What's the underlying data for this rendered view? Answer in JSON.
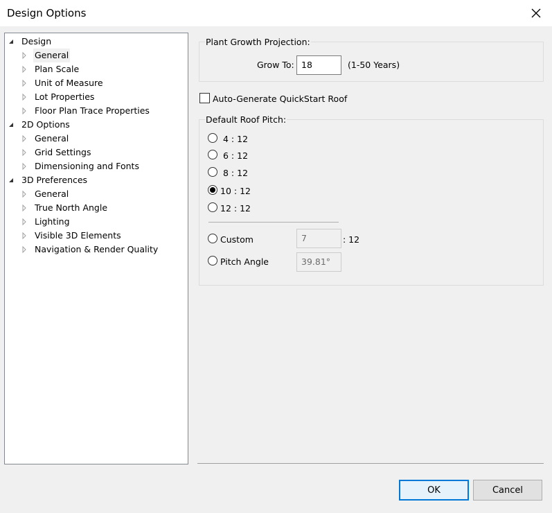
{
  "window": {
    "title": "Design Options"
  },
  "tree": {
    "items": [
      {
        "label": "Design",
        "level": 0,
        "expanded": true
      },
      {
        "label": "General",
        "level": 1,
        "selected": true
      },
      {
        "label": "Plan Scale",
        "level": 1
      },
      {
        "label": "Unit of Measure",
        "level": 1
      },
      {
        "label": "Lot Properties",
        "level": 1
      },
      {
        "label": "Floor Plan Trace Properties",
        "level": 1
      },
      {
        "label": "2D Options",
        "level": 0,
        "expanded": true
      },
      {
        "label": "General",
        "level": 1
      },
      {
        "label": "Grid Settings",
        "level": 1
      },
      {
        "label": "Dimensioning and Fonts",
        "level": 1
      },
      {
        "label": "3D Preferences",
        "level": 0,
        "expanded": true
      },
      {
        "label": "General",
        "level": 1
      },
      {
        "label": "True North Angle",
        "level": 1
      },
      {
        "label": "Lighting",
        "level": 1
      },
      {
        "label": "Visible 3D Elements",
        "level": 1
      },
      {
        "label": "Navigation & Render Quality",
        "level": 1
      }
    ]
  },
  "plant_growth": {
    "group_title": "Plant Growth Projection:",
    "grow_to_label": "Grow To:",
    "grow_to_value": "18",
    "range_hint": "(1-50 Years)"
  },
  "auto_roof": {
    "label": "Auto-Generate QuickStart Roof",
    "checked": false
  },
  "roof_pitch": {
    "group_title": "Default Roof Pitch:",
    "options": [
      {
        "label": "4 : 12",
        "checked": false
      },
      {
        "label": "6 : 12",
        "checked": false
      },
      {
        "label": "8 : 12",
        "checked": false
      },
      {
        "label": "10 : 12",
        "checked": true
      },
      {
        "label": "12 : 12",
        "checked": false
      }
    ],
    "custom_label": "Custom",
    "custom_value": "7",
    "custom_suffix": ": 12",
    "pitch_angle_label": "Pitch Angle",
    "pitch_angle_value": "39.81°"
  },
  "buttons": {
    "ok": "OK",
    "cancel": "Cancel"
  }
}
